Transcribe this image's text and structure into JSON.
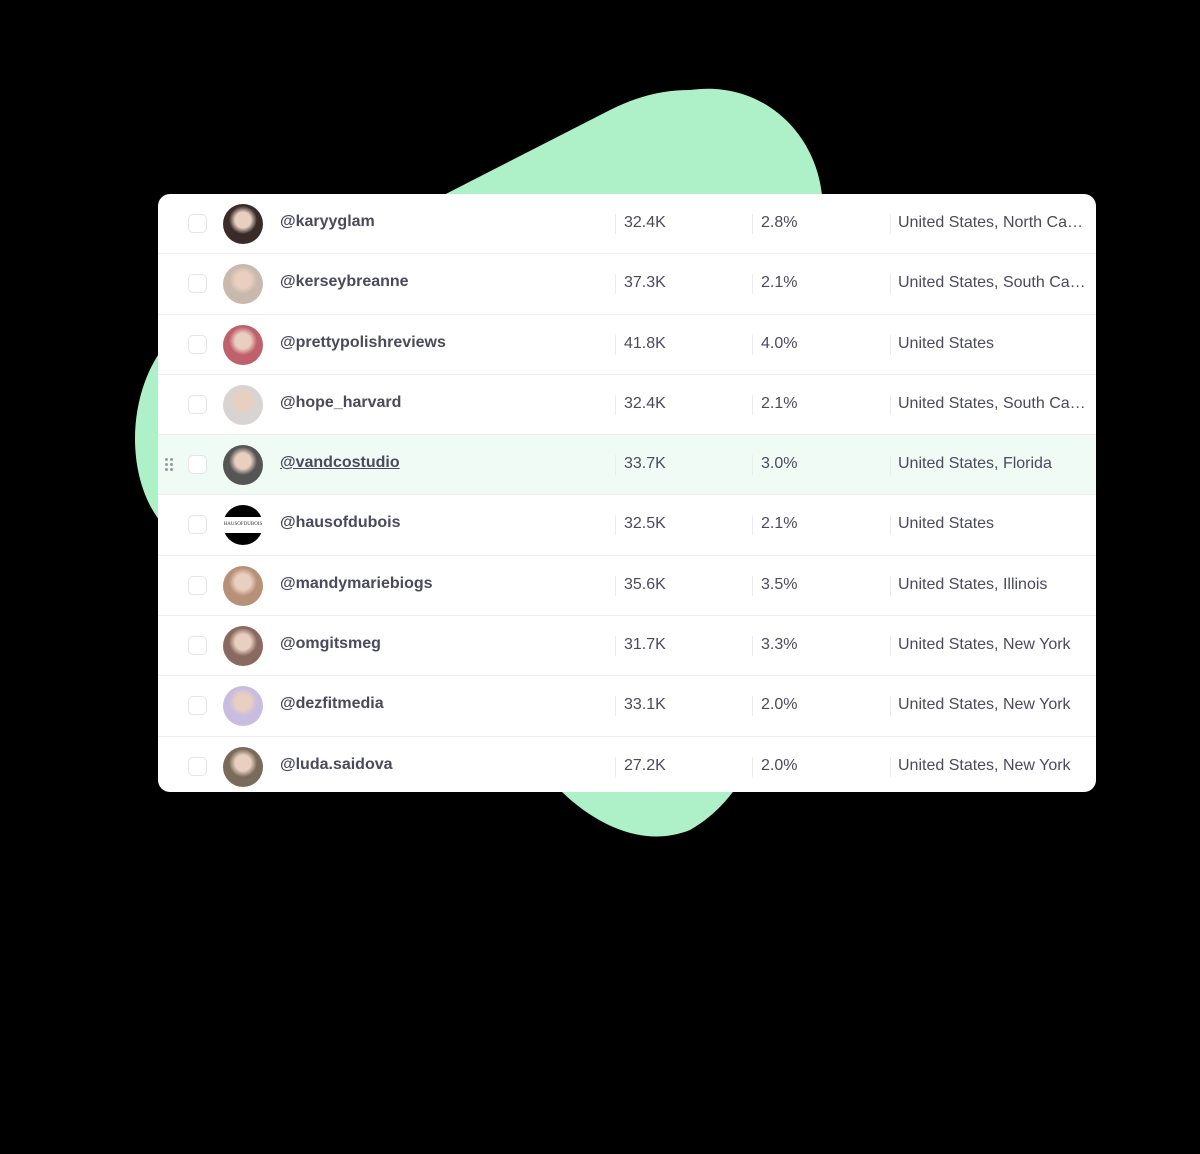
{
  "colors": {
    "blob": "#aef0c8",
    "hover_row": "#f1fbf5",
    "text": "#4a4a5c"
  },
  "rows": [
    {
      "handle": "@karyyglam",
      "followers": "32.4K",
      "engagement": "2.8%",
      "location": "United States, North Carolina",
      "avatar": "#3a2a28"
    },
    {
      "handle": "@kerseybreanne",
      "followers": "37.3K",
      "engagement": "2.1%",
      "location": "United States, South Carolina",
      "avatar": "#c9b8ac"
    },
    {
      "handle": "@prettypolishreviews",
      "followers": "41.8K",
      "engagement": "4.0%",
      "location": "United States",
      "avatar": "#c0606a"
    },
    {
      "handle": "@hope_harvard",
      "followers": "32.4K",
      "engagement": "2.1%",
      "location": "United States, South Carolina",
      "avatar": "#d8d4d2"
    },
    {
      "handle": "@vandcostudio",
      "followers": "33.7K",
      "engagement": "3.0%",
      "location": "United States, Florida",
      "avatar": "#555",
      "hover": true
    },
    {
      "handle": "@hausofdubois",
      "followers": "32.5K",
      "engagement": "2.1%",
      "location": "United States",
      "avatar": "logo",
      "logo_text": "HAUSOFDUBOIS"
    },
    {
      "handle": "@mandymariebiogs",
      "followers": "35.6K",
      "engagement": "3.5%",
      "location": "United States, Illinois",
      "avatar": "#b89078"
    },
    {
      "handle": "@omgitsmeg",
      "followers": "31.7K",
      "engagement": "3.3%",
      "location": "United States, New York",
      "avatar": "#8a6a60"
    },
    {
      "handle": "@dezfitmedia",
      "followers": "33.1K",
      "engagement": "2.0%",
      "location": "United States, New York",
      "avatar": "#c8bce0"
    },
    {
      "handle": "@luda.saidova",
      "followers": "27.2K",
      "engagement": "2.0%",
      "location": "United States, New York",
      "avatar": "#7a6a5a"
    }
  ]
}
